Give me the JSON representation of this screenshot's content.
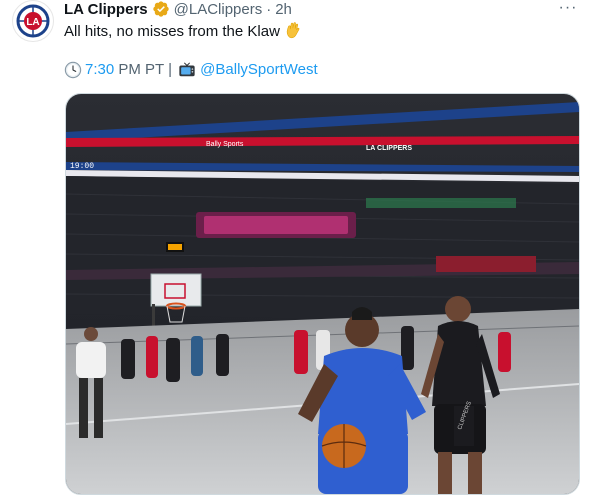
{
  "tweet": {
    "account_name": "LA Clippers",
    "handle": "@LAClippers",
    "separator": "·",
    "timestamp": "2h",
    "more_label": "···",
    "body_text": "All hits, no misses from the Klaw",
    "time_label": "7:30",
    "time_suffix": " PM PT | ",
    "broadcast_link": "@BallySportWest",
    "logo_text": "LA"
  },
  "media": {
    "arena_banner_text": "LA CLIPPERS",
    "sponsor_text": "Bally Sports",
    "clock_text": "19:00",
    "jersey_text": "CLIPPERS",
    "brand_color": "#c8102e",
    "brand_blue": "#1d428a"
  },
  "colors": {
    "link": "#1d9bf0",
    "muted": "#536471",
    "verified": "#e8a917"
  },
  "icons": [
    "clippers-logo-icon",
    "verified-badge-icon",
    "more-icon",
    "wave-emoji-icon",
    "clock-emoji-icon",
    "tv-emoji-icon"
  ]
}
